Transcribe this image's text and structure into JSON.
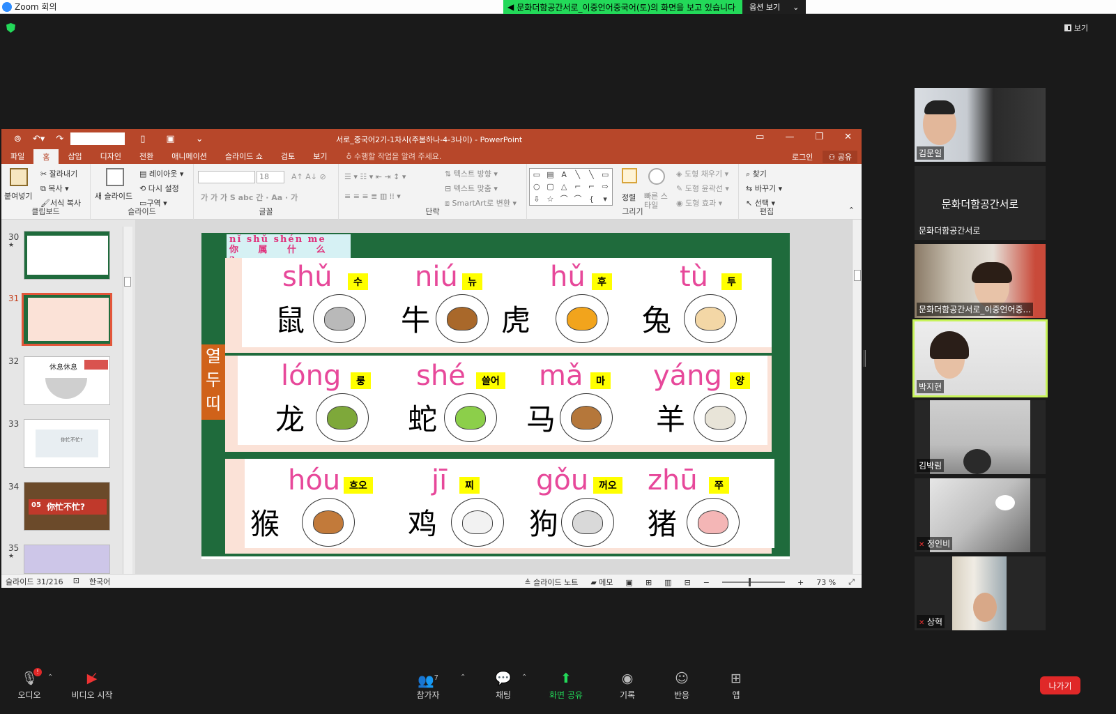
{
  "zoom": {
    "window_title": "Zoom 회의",
    "share_banner": "문화더함공간서로_이중언어중국어(토)의 화면을 보고 있습니다",
    "options_label": "옵션 보기",
    "view_label": "보기"
  },
  "ppt": {
    "title": "서로_중국어2기-1차시(주봄하나-4-3나이) - PowerPoint",
    "tabs": [
      "파일",
      "홈",
      "삽입",
      "디자인",
      "전환",
      "애니메이션",
      "슬라이드 쇼",
      "검토",
      "보기"
    ],
    "tell_me": "수행할 작업을 알려 주세요.",
    "login": "로그인",
    "share": "공유",
    "ribbon": {
      "paste": "붙여넣기",
      "cut": "잘라내기",
      "copy": "복사",
      "format_painter": "서식 복사",
      "clipboard": "클립보드",
      "new_slide": "새 슬라이드",
      "layout": "레이아웃",
      "reset": "다시 설정",
      "section": "구역",
      "slides": "슬라이드",
      "font_size": "18",
      "font": "글꼴",
      "text_direction": "텍스트 방향",
      "align_text": "텍스트 맞춤",
      "smartart": "SmartArt로 변환",
      "paragraph": "단락",
      "arrange": "정렬",
      "quick_styles": "빠른 스타일",
      "shape_fill": "도형 채우기",
      "shape_outline": "도형 윤곽선",
      "shape_effects": "도형 효과",
      "drawing": "그리기",
      "find": "찾기",
      "replace": "바꾸기",
      "select": "선택",
      "editing": "편집"
    },
    "thumbs": [
      {
        "num": "30",
        "star": "★"
      },
      {
        "num": "31",
        "star": ""
      },
      {
        "num": "32",
        "star": ""
      },
      {
        "num": "33",
        "star": ""
      },
      {
        "num": "34",
        "star": ""
      },
      {
        "num": "35",
        "star": "★"
      }
    ],
    "thumb_texts": {
      "t32": "休息休息",
      "t33": "你忙不忙?",
      "t34": "你忙不忙?",
      "t34num": "05"
    },
    "status": {
      "slide": "슬라이드 31/216",
      "lang": "한국어",
      "notes": "슬라이드 노트",
      "memo": "메모",
      "zoom": "73 %"
    }
  },
  "slide": {
    "header_pinyin": "nǐ shǔ shén me",
    "header_hanzi": "你 属 什 么 ?",
    "side_tag": "열두띠",
    "rows": [
      [
        {
          "py": "shǔ",
          "kr": "수",
          "hz": "鼠",
          "color": "#b9b9b9"
        },
        {
          "py": "niú",
          "kr": "뉴",
          "hz": "牛",
          "color": "#a9682a"
        },
        {
          "py": "hǔ",
          "kr": "후",
          "hz": "虎",
          "color": "#f2a41c"
        },
        {
          "py": "tù",
          "kr": "투",
          "hz": "兔",
          "color": "#f3d7a6"
        }
      ],
      [
        {
          "py": "lóng",
          "kr": "룽",
          "hz": "龙",
          "color": "#7ea83a"
        },
        {
          "py": "shé",
          "kr": "쓸어",
          "hz": "蛇",
          "color": "#8ccf4a"
        },
        {
          "py": "mǎ",
          "kr": "마",
          "hz": "马",
          "color": "#b5773a"
        },
        {
          "py": "yáng",
          "kr": "양",
          "hz": "羊",
          "color": "#e8e4d8"
        }
      ],
      [
        {
          "py": "hóu",
          "kr": "흐오",
          "hz": "猴",
          "color": "#c27a3a"
        },
        {
          "py": "jī",
          "kr": "찌",
          "hz": "鸡",
          "color": "#f2f2f2"
        },
        {
          "py": "gǒu",
          "kr": "꺼오",
          "hz": "狗",
          "color": "#d9d9d9"
        },
        {
          "py": "zhū",
          "kr": "쭈",
          "hz": "猪",
          "color": "#f4b6b6"
        }
      ]
    ]
  },
  "participants": [
    {
      "name": "김문일",
      "muted": false
    },
    {
      "name": "문화더함공간서로",
      "muted": false,
      "no_video": true
    },
    {
      "name": "문화더함공간서로_이중언어중...",
      "muted": false
    },
    {
      "name": "박지현",
      "muted": false,
      "speaking": true
    },
    {
      "name": "김박림",
      "muted": false
    },
    {
      "name": "정인비",
      "muted": true
    },
    {
      "name": "상혁",
      "muted": true
    }
  ],
  "toolbar": {
    "audio": "오디오",
    "video": "비디오 시작",
    "participants": "참가자",
    "participants_count": "7",
    "chat": "채팅",
    "share": "화면 공유",
    "record": "기록",
    "reactions": "반응",
    "apps": "앱",
    "leave": "나가기",
    "audio_badge": "!"
  }
}
